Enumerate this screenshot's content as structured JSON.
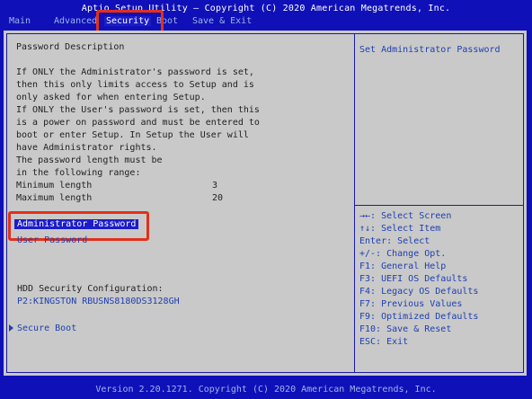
{
  "header": {
    "title": "Aptio Setup Utility – Copyright (C) 2020 American Megatrends, Inc."
  },
  "tabs": [
    {
      "label": "Main"
    },
    {
      "label": "Advanced"
    },
    {
      "label": "Security"
    },
    {
      "label": "Boot"
    },
    {
      "label": "Save & Exit"
    }
  ],
  "active_tab": "Security",
  "main": {
    "description_title": "Password Description",
    "description_lines": [
      "If ONLY the Administrator's password is set,",
      "then this only limits access to Setup and is",
      "only asked for when entering Setup.",
      "If ONLY the User's password is set, then this",
      "is a power on password and must be entered to",
      "boot or enter Setup. In Setup the User will",
      "have Administrator rights.",
      "The password length must be",
      "in the following range:"
    ],
    "min_length_label": "Minimum length",
    "min_length_value": "3",
    "max_length_label": "Maximum length",
    "max_length_value": "20",
    "admin_password": "Administrator Password",
    "user_password": "User Password",
    "hdd_security_title": "HDD Security Configuration:",
    "hdd_device": "P2:KINGSTON RBUSNS8180DS3128GH",
    "secure_boot": "Secure Boot"
  },
  "help": {
    "text": "Set Administrator Password"
  },
  "keys": [
    "→←: Select Screen",
    "↑↓: Select Item",
    "Enter: Select",
    "+/-: Change Opt.",
    "F1: General Help",
    "F3: UEFI OS Defaults",
    "F4: Legacy OS Defaults",
    "F7: Previous Values",
    "F9: Optimized Defaults",
    "F10: Save & Reset",
    "ESC: Exit"
  ],
  "footer": {
    "text": "Version 2.20.1271. Copyright (C) 2020 American Megatrends, Inc."
  },
  "colors": {
    "background": "#1010b8",
    "panel": "#c9c9c9",
    "highlight_box": "#e2301a",
    "selection": "#1c1cc8",
    "link_text": "#1e3fb0"
  }
}
